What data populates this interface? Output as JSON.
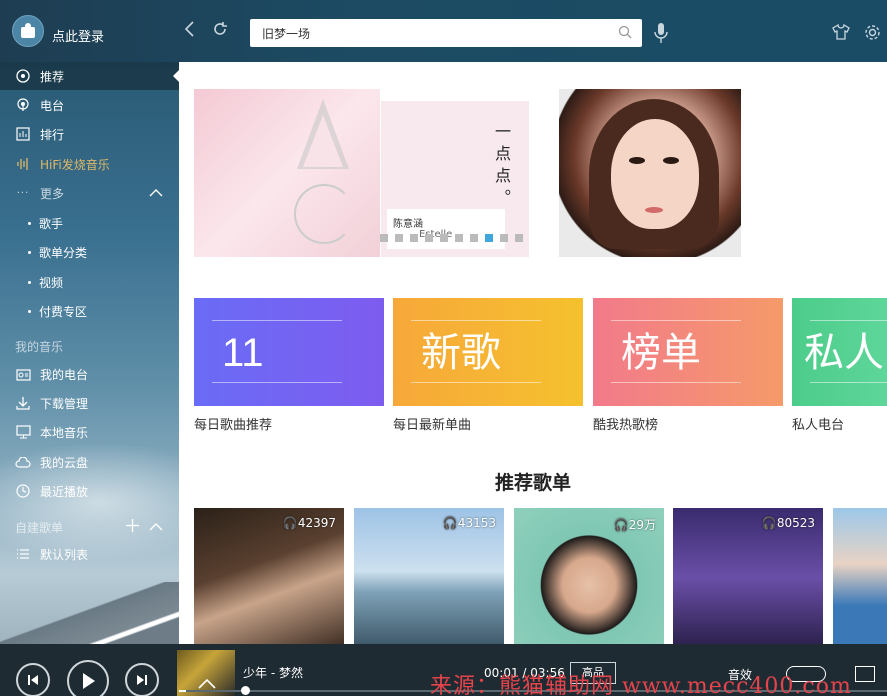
{
  "header": {
    "login_text": "点此登录",
    "search_value": "旧梦一场"
  },
  "sidebar": {
    "items": [
      {
        "label": "推荐",
        "icon": "disc-icon"
      },
      {
        "label": "电台",
        "icon": "radio-icon"
      },
      {
        "label": "排行",
        "icon": "chart-icon"
      },
      {
        "label": "HiFi发烧音乐",
        "icon": "waveform-icon"
      },
      {
        "label": "更多",
        "icon": "ellipsis-icon"
      },
      {
        "label": "歌手"
      },
      {
        "label": "歌单分类"
      },
      {
        "label": "视频"
      },
      {
        "label": "付费专区"
      }
    ],
    "my_music_title": "我的音乐",
    "my_music": [
      {
        "label": "我的电台",
        "icon": "radio-box-icon"
      },
      {
        "label": "下载管理",
        "icon": "download-icon"
      },
      {
        "label": "本地音乐",
        "icon": "monitor-icon"
      },
      {
        "label": "我的云盘",
        "icon": "cloud-icon"
      },
      {
        "label": "最近播放",
        "icon": "clock-icon"
      }
    ],
    "playlist_title": "自建歌单",
    "playlists": [
      {
        "label": "默认列表",
        "icon": "list-icon"
      }
    ]
  },
  "banner": {
    "slide2_vertical_text": "一点点。",
    "slide2_artist": "陈意涵",
    "slide2_artist_en": "Estelle",
    "active_dot": 7,
    "dot_count": 10
  },
  "tiles": [
    {
      "big": "11",
      "label": "每日歌曲推荐",
      "color_from": "#6a6cf5",
      "color_to": "#7d5cf0"
    },
    {
      "big": "新歌",
      "label": "每日最新单曲",
      "color_from": "#f7a83a",
      "color_to": "#f5c12e"
    },
    {
      "big": "榜单",
      "label": "酷我热歌榜",
      "color_from": "#f27a8a",
      "color_to": "#f59a6a"
    },
    {
      "big": "私人",
      "label": "私人电台",
      "color_from": "#4ccc8a",
      "color_to": "#5ed69a"
    }
  ],
  "section_title": "推荐歌单",
  "playlists": [
    {
      "count": "42397"
    },
    {
      "count": "43153"
    },
    {
      "count": "29万"
    },
    {
      "count": "80523"
    },
    {
      "count": ""
    }
  ],
  "player": {
    "song": "少年 - 梦然",
    "time": "00:01 / 03:56",
    "quality": "高品",
    "sound_label": "音效",
    "progress": 0.01
  },
  "watermark": "来源：熊猫辅助网 www.mecc400.com"
}
